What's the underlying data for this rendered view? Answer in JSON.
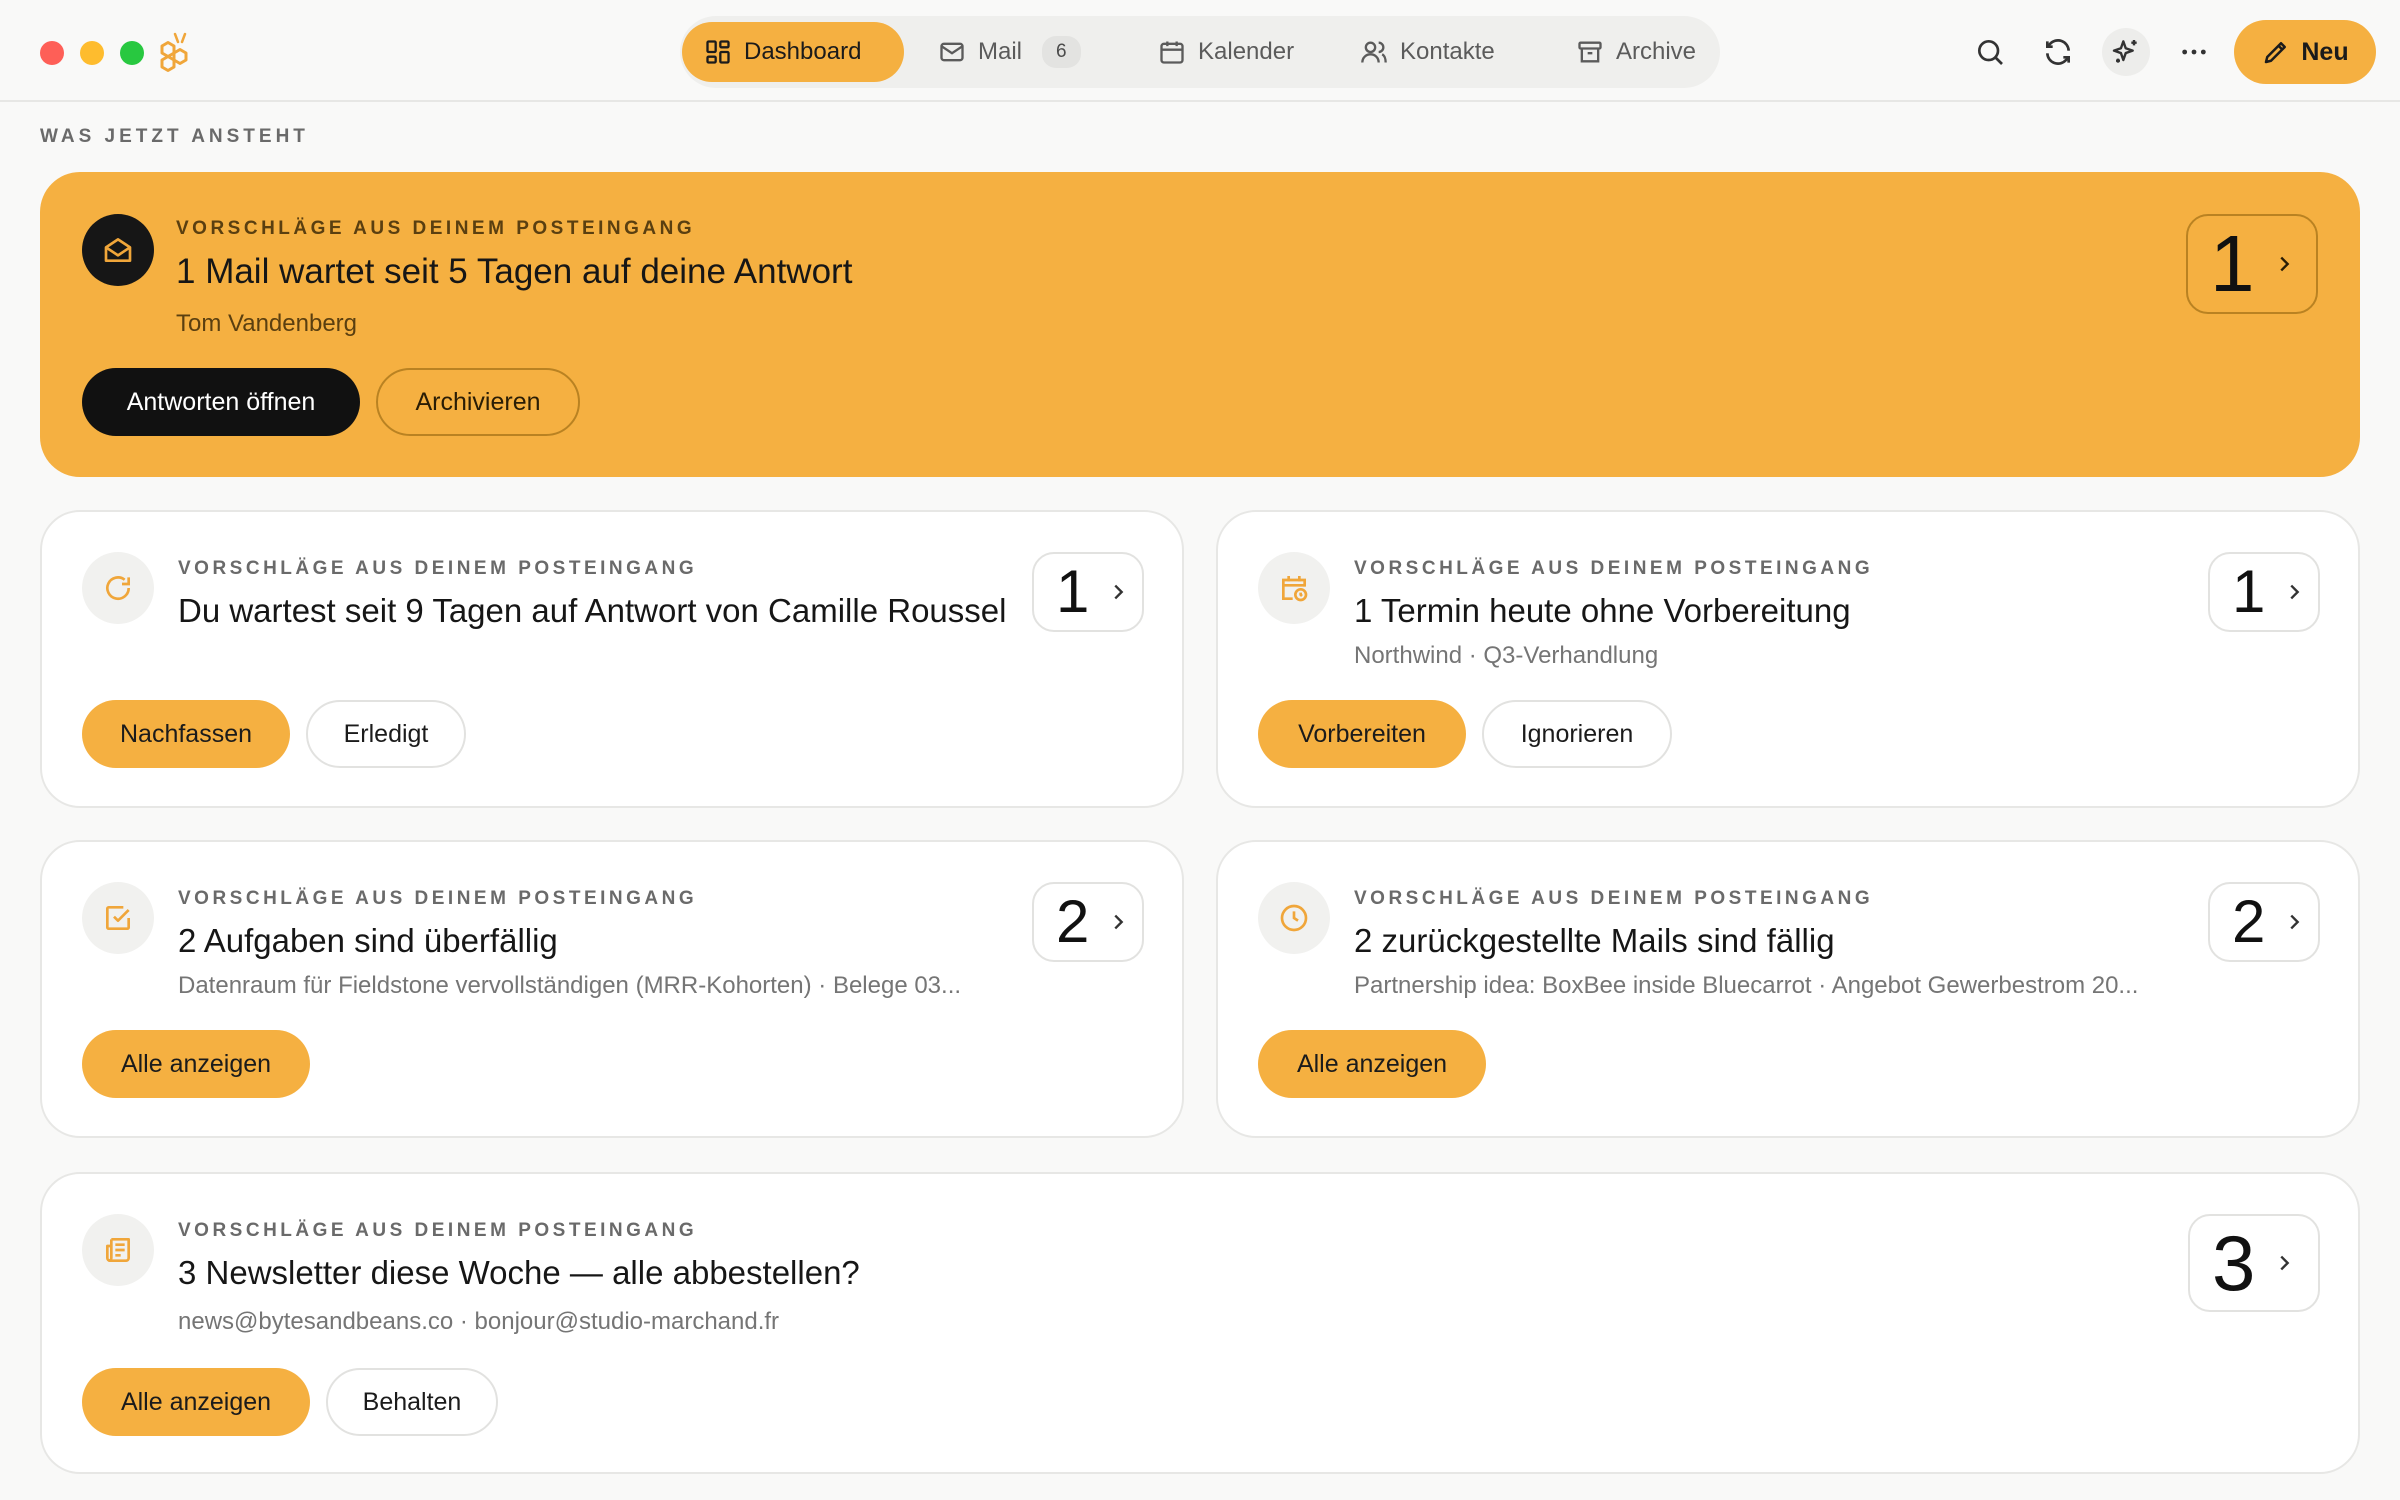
{
  "nav": {
    "tabs": [
      {
        "label": "Dashboard",
        "icon": "dashboard-icon",
        "active": true
      },
      {
        "label": "Mail",
        "icon": "mail-icon",
        "badge": "6"
      },
      {
        "label": "Kalender",
        "icon": "calendar-icon"
      },
      {
        "label": "Kontakte",
        "icon": "contacts-icon"
      },
      {
        "label": "Archive",
        "icon": "archive-icon"
      }
    ]
  },
  "toolbar": {
    "new_label": "Neu",
    "icons": [
      "search-icon",
      "refresh-icon",
      "sparkle-icon",
      "more-icon"
    ]
  },
  "section": {
    "label": "WAS JETZT ANSTEHT"
  },
  "cards": [
    {
      "eyebrow": "VORSCHLÄGE AUS DEINEM POSTEINGANG",
      "title": "1 Mail wartet seit 5 Tagen auf deine Antwort",
      "subtitle": "Tom Vandenberg",
      "count": "1",
      "icon": "mail-open-icon",
      "actions": [
        "Antworten öffnen",
        "Archivieren"
      ]
    },
    {
      "eyebrow": "VORSCHLÄGE AUS DEINEM POSTEINGANG",
      "title": "Du wartest seit 9 Tagen auf Antwort von Camille Roussel",
      "count": "1",
      "icon": "refresh-icon",
      "actions": [
        "Nachfassen",
        "Erledigt"
      ]
    },
    {
      "eyebrow": "VORSCHLÄGE AUS DEINEM POSTEINGANG",
      "title": "1 Termin heute ohne Vorbereitung",
      "subtitle": "Northwind · Q3-Verhandlung",
      "count": "1",
      "icon": "calendar-clock-icon",
      "actions": [
        "Vorbereiten",
        "Ignorieren"
      ]
    },
    {
      "eyebrow": "VORSCHLÄGE AUS DEINEM POSTEINGANG",
      "title": "2 Aufgaben sind überfällig",
      "subtitle": "Datenraum für Fieldstone vervollständigen (MRR-Kohorten) · Belege 03...",
      "count": "2",
      "icon": "checkbox-icon",
      "actions": [
        "Alle anzeigen"
      ]
    },
    {
      "eyebrow": "VORSCHLÄGE AUS DEINEM POSTEINGANG",
      "title": "2 zurückgestellte Mails sind fällig",
      "subtitle": "Partnership idea: BoxBee inside Bluecarrot · Angebot Gewerbestrom 20...",
      "count": "2",
      "icon": "clock-icon",
      "actions": [
        "Alle anzeigen"
      ]
    },
    {
      "eyebrow": "VORSCHLÄGE AUS DEINEM POSTEINGANG",
      "title": "3 Newsletter diese Woche — alle abbestellen?",
      "subtitle": "news@bytesandbeans.co · bonjour@studio-marchand.fr",
      "count": "3",
      "icon": "newsletter-icon",
      "actions": [
        "Alle anzeigen",
        "Behalten"
      ]
    }
  ],
  "colors": {
    "accent": "#f5b041",
    "dark": "#111111",
    "card_border": "#e7e7e5",
    "icon_accent": "#f0a63a"
  }
}
